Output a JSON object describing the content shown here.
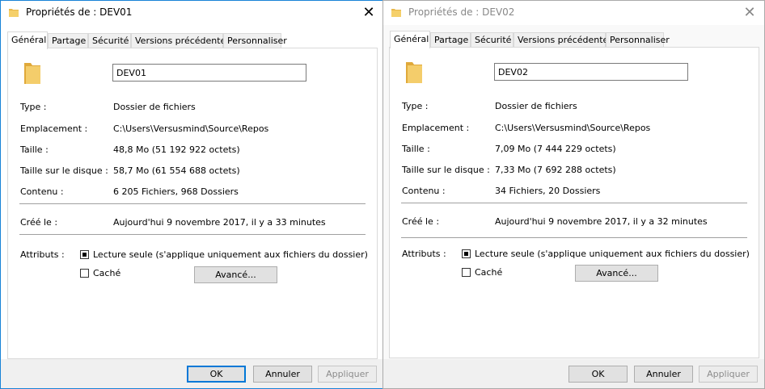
{
  "windows": [
    {
      "title": "Propriétés de : DEV01",
      "tabs": [
        "Général",
        "Partage",
        "Sécurité",
        "Versions précédentes",
        "Personnaliser"
      ],
      "folder_name": "DEV01",
      "properties": [
        {
          "label": "Type :",
          "value": "Dossier de fichiers"
        },
        {
          "label": "Emplacement :",
          "value": "C:\\Users\\Versusmind\\Source\\Repos"
        },
        {
          "label": "Taille :",
          "value": "48,8 Mo (51 192 922 octets)"
        },
        {
          "label": "Taille sur le disque :",
          "value": "58,7 Mo (61 554 688 octets)"
        },
        {
          "label": "Contenu :",
          "value": "6 205 Fichiers, 968 Dossiers"
        }
      ],
      "created": {
        "label": "Créé le :",
        "value": "Aujourd'hui 9 novembre 2017, il y a 33 minutes"
      },
      "attributes_label": "Attributs :",
      "readonly_label": "Lecture seule (s'applique uniquement aux fichiers du dossier)",
      "hidden_label": "Caché",
      "advanced_label": "Avancé...",
      "ok_label": "OK",
      "cancel_label": "Annuler",
      "apply_label": "Appliquer"
    },
    {
      "title": "Propriétés de : DEV02",
      "tabs": [
        "Général",
        "Partage",
        "Sécurité",
        "Versions précédentes",
        "Personnaliser"
      ],
      "folder_name": "DEV02",
      "properties": [
        {
          "label": "Type :",
          "value": "Dossier de fichiers"
        },
        {
          "label": "Emplacement :",
          "value": "C:\\Users\\Versusmind\\Source\\Repos"
        },
        {
          "label": "Taille :",
          "value": "7,09 Mo (7 444 229 octets)"
        },
        {
          "label": "Taille sur le disque :",
          "value": "7,33 Mo (7 692 288 octets)"
        },
        {
          "label": "Contenu :",
          "value": "34 Fichiers, 20 Dossiers"
        }
      ],
      "created": {
        "label": "Créé le :",
        "value": "Aujourd'hui 9 novembre 2017, il y a 32 minutes"
      },
      "attributes_label": "Attributs :",
      "readonly_label": "Lecture seule (s'applique uniquement aux fichiers du dossier)",
      "hidden_label": "Caché",
      "advanced_label": "Avancé...",
      "ok_label": "OK",
      "cancel_label": "Annuler",
      "apply_label": "Appliquer"
    }
  ],
  "icons": {
    "folder": "folder-icon",
    "close": "close-icon"
  },
  "colors": {
    "accent": "#0078d7",
    "folder": "#f2c55c"
  }
}
